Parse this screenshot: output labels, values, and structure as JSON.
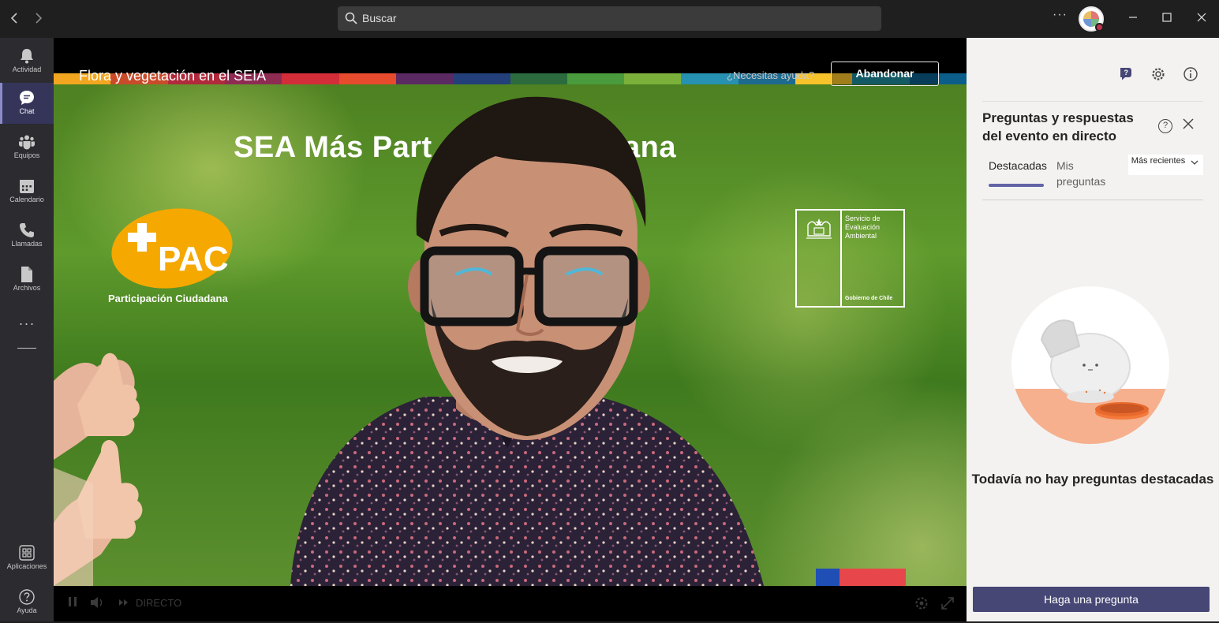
{
  "titlebar": {
    "back_icon": "chevron-left-icon",
    "forward_icon": "chevron-right-icon",
    "search_placeholder": "Buscar",
    "more_label": "···",
    "minimize": "—",
    "maximize": "☐",
    "close": "✕"
  },
  "rail": {
    "items": [
      {
        "label": "Actividad",
        "icon": "bell-icon"
      },
      {
        "label": "Chat",
        "icon": "chat-icon"
      },
      {
        "label": "Equipos",
        "icon": "teams-icon"
      },
      {
        "label": "Calendario",
        "icon": "calendar-icon"
      },
      {
        "label": "Llamadas",
        "icon": "phone-icon"
      },
      {
        "label": "Archivos",
        "icon": "file-icon"
      }
    ],
    "more": "···",
    "apps_label": "Aplicaciones",
    "help_label": "Ayuda"
  },
  "event": {
    "title": "Flora y vegetación en el SEIA",
    "help_link": "¿Necesitas ayuda?",
    "leave_button": "Abandonar",
    "slide_headline": "SEA Más Part          Ciudadana",
    "pac_logo_text": "+PAC",
    "pac_label": "Participación Ciudadana",
    "sea_name": "Servicio de Evaluación Ambiental",
    "sea_gov": "Gobierno de Chile",
    "live_label": "DIRECTO"
  },
  "colors": {
    "accent": "#6264a7",
    "ask_button": "#464775",
    "pac_orange": "#f5a800"
  },
  "qa_panel": {
    "title": "Preguntas y respuestas del evento en directo",
    "tabs": [
      "Destacadas",
      "Mis preguntas"
    ],
    "active_tab": "Destacadas",
    "sort_label": "Más recientes",
    "empty_text": "Todavía no hay preguntas destacadas",
    "ask_button": "Haga una pregunta"
  }
}
